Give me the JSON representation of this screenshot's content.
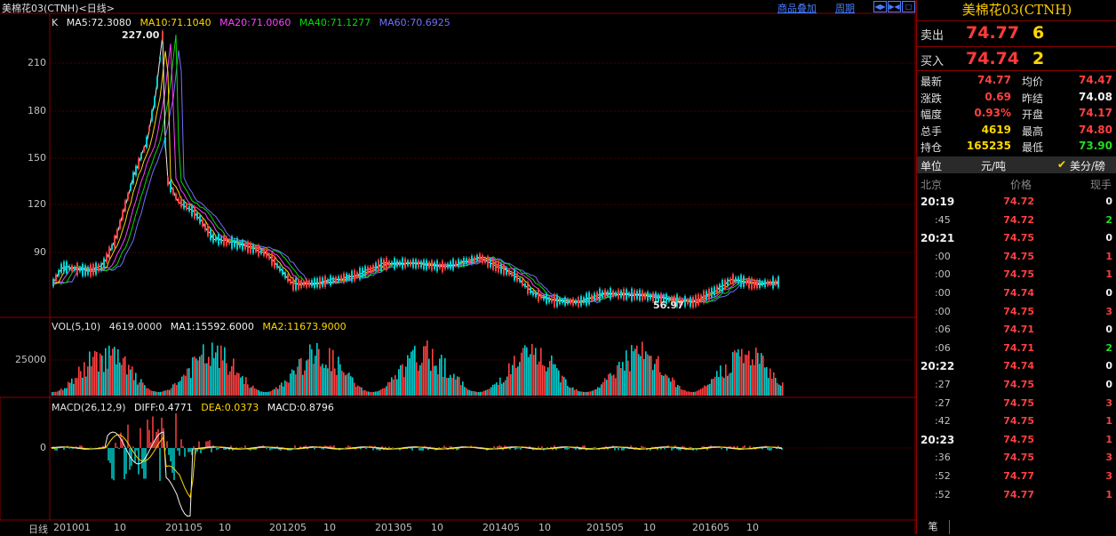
{
  "window": {
    "title": "美棉花03(CTNH)<日线>"
  },
  "toolbar": {
    "overlay_label": "商品叠加",
    "period_label": "周期"
  },
  "price_legend": {
    "prefix": "K",
    "ma5": "MA5:72.3080",
    "ma10": "MA10:71.1040",
    "ma20": "MA20:71.0060",
    "ma40": "MA40:71.1277",
    "ma60": "MA60:70.6925"
  },
  "price_annotations": {
    "high": "227.00",
    "low": "56.97"
  },
  "vol_legend": {
    "prefix": "VOL(5,10)",
    "value": "4619.0000",
    "ma1": "MA1:15592.6000",
    "ma2": "MA2:11673.9000"
  },
  "macd_legend": {
    "prefix": "MACD(26,12,9)",
    "diff": "DIFF:0.4771",
    "dea": "DEA:0.0373",
    "macd": "MACD:0.8796"
  },
  "axis": {
    "price_ticks": [
      "210",
      "180",
      "150",
      "120",
      "90"
    ],
    "vol_ticks": [
      "25000"
    ],
    "macd_ticks": [
      "0"
    ],
    "x_first": "日线",
    "x_ticks": [
      "201001",
      "10",
      "201105",
      "10",
      "201205",
      "10",
      "201305",
      "10",
      "201405",
      "10",
      "201505",
      "10",
      "201605",
      "10"
    ]
  },
  "colors": {
    "ma5": "#f0f0f0",
    "ma10": "#ffd700",
    "ma20": "#ff40ff",
    "ma40": "#00dd00",
    "ma60": "#7070ff",
    "up": "#ff4040",
    "down": "#00d0d0",
    "grid": "#8b0000",
    "link": "#4a7cff"
  },
  "quote": {
    "title": "美棉花03(CTNH)",
    "sell_label": "卖出",
    "sell_price": "74.77",
    "sell_qty": "6",
    "buy_label": "买入",
    "buy_price": "74.74",
    "buy_qty": "2",
    "rows": [
      {
        "l1": "最新",
        "v1": "74.77",
        "c1": "red",
        "l2": "均价",
        "v2": "74.47",
        "c2": "red"
      },
      {
        "l1": "涨跌",
        "v1": "0.69",
        "c1": "red",
        "l2": "昨结",
        "v2": "74.08",
        "c2": "white"
      },
      {
        "l1": "幅度",
        "v1": "0.93%",
        "c1": "red",
        "l2": "开盘",
        "v2": "74.17",
        "c2": "red"
      },
      {
        "l1": "总手",
        "v1": "4619",
        "c1": "yellow",
        "l2": "最高",
        "v2": "74.80",
        "c2": "red"
      },
      {
        "l1": "持仓",
        "v1": "165235",
        "c1": "yellow",
        "l2": "最低",
        "v2": "73.90",
        "c2": "green"
      }
    ],
    "unit_label": "单位",
    "unit_value": "元/吨",
    "unit_alt": "美分/磅",
    "unit_alt_checked": true
  },
  "ticks_header": {
    "time": "北京",
    "price": "价格",
    "qty": "现手"
  },
  "ticks": [
    {
      "time": "20:19",
      "full": true,
      "price": "74.72",
      "qty": "0",
      "qc": "white"
    },
    {
      "time": ":45",
      "full": false,
      "price": "74.72",
      "qty": "2",
      "qc": "green"
    },
    {
      "time": "20:21",
      "full": true,
      "price": "74.75",
      "qty": "0",
      "qc": "white"
    },
    {
      "time": ":00",
      "full": false,
      "price": "74.75",
      "qty": "1",
      "qc": "red"
    },
    {
      "time": ":00",
      "full": false,
      "price": "74.75",
      "qty": "1",
      "qc": "red"
    },
    {
      "time": ":00",
      "full": false,
      "price": "74.74",
      "qty": "0",
      "qc": "white"
    },
    {
      "time": ":00",
      "full": false,
      "price": "74.75",
      "qty": "3",
      "qc": "red"
    },
    {
      "time": ":06",
      "full": false,
      "price": "74.71",
      "qty": "0",
      "qc": "white"
    },
    {
      "time": ":06",
      "full": false,
      "price": "74.71",
      "qty": "2",
      "qc": "green"
    },
    {
      "time": "20:22",
      "full": true,
      "price": "74.74",
      "qty": "0",
      "qc": "white"
    },
    {
      "time": ":27",
      "full": false,
      "price": "74.75",
      "qty": "0",
      "qc": "white"
    },
    {
      "time": ":27",
      "full": false,
      "price": "74.75",
      "qty": "3",
      "qc": "red"
    },
    {
      "time": ":42",
      "full": false,
      "price": "74.75",
      "qty": "1",
      "qc": "red"
    },
    {
      "time": "20:23",
      "full": true,
      "price": "74.75",
      "qty": "1",
      "qc": "red"
    },
    {
      "time": ":36",
      "full": false,
      "price": "74.75",
      "qty": "3",
      "qc": "red"
    },
    {
      "time": ":52",
      "full": false,
      "price": "74.77",
      "qty": "3",
      "qc": "red"
    },
    {
      "time": ":52",
      "full": false,
      "price": "74.77",
      "qty": "1",
      "qc": "red"
    }
  ],
  "bottom_tab": "笔"
}
